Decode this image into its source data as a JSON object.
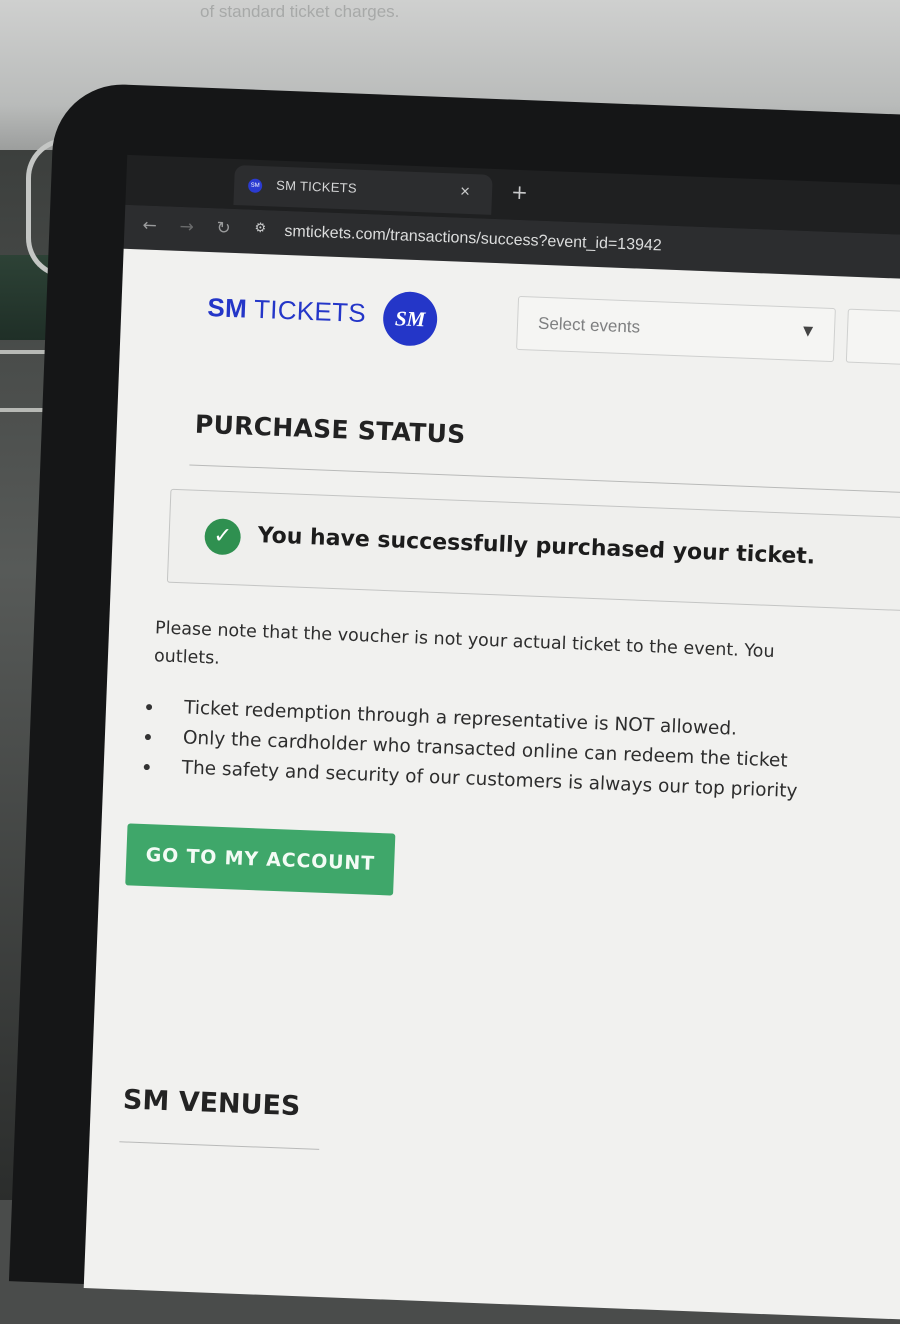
{
  "background": {
    "paper_text": "of standard ticket charges."
  },
  "browser": {
    "tab": {
      "favicon": "SM",
      "title": "SM TICKETS",
      "close_glyph": "×"
    },
    "new_tab_glyph": "+",
    "nav": {
      "back_glyph": "←",
      "forward_glyph": "→",
      "reload_glyph": "↻",
      "site_info_glyph": "⚙"
    },
    "url": "smtickets.com/transactions/success?event_id=13942"
  },
  "header": {
    "logo_bold": "SM",
    "logo_rest": "TICKETS",
    "badge_text": "SM",
    "select": {
      "placeholder": "Select events",
      "caret": "▼"
    }
  },
  "main": {
    "title": "PURCHASE STATUS",
    "success": {
      "icon": "✓",
      "message": "You have successfully purchased your ticket."
    },
    "note_line1": "Please note that the voucher is not your actual ticket to the event. You",
    "note_line2": "outlets.",
    "bullets": [
      "Ticket redemption through a representative is NOT allowed.",
      "Only the cardholder who transacted online can redeem the ticket",
      "The safety and security of our customers is always our top priority"
    ],
    "account_button": "GO TO MY ACCOUNT"
  },
  "footer": {
    "venues_title": "SM VENUES"
  },
  "colors": {
    "brand_blue": "#2436c8",
    "success_green": "#2f9050",
    "button_green": "#3fa76a"
  }
}
